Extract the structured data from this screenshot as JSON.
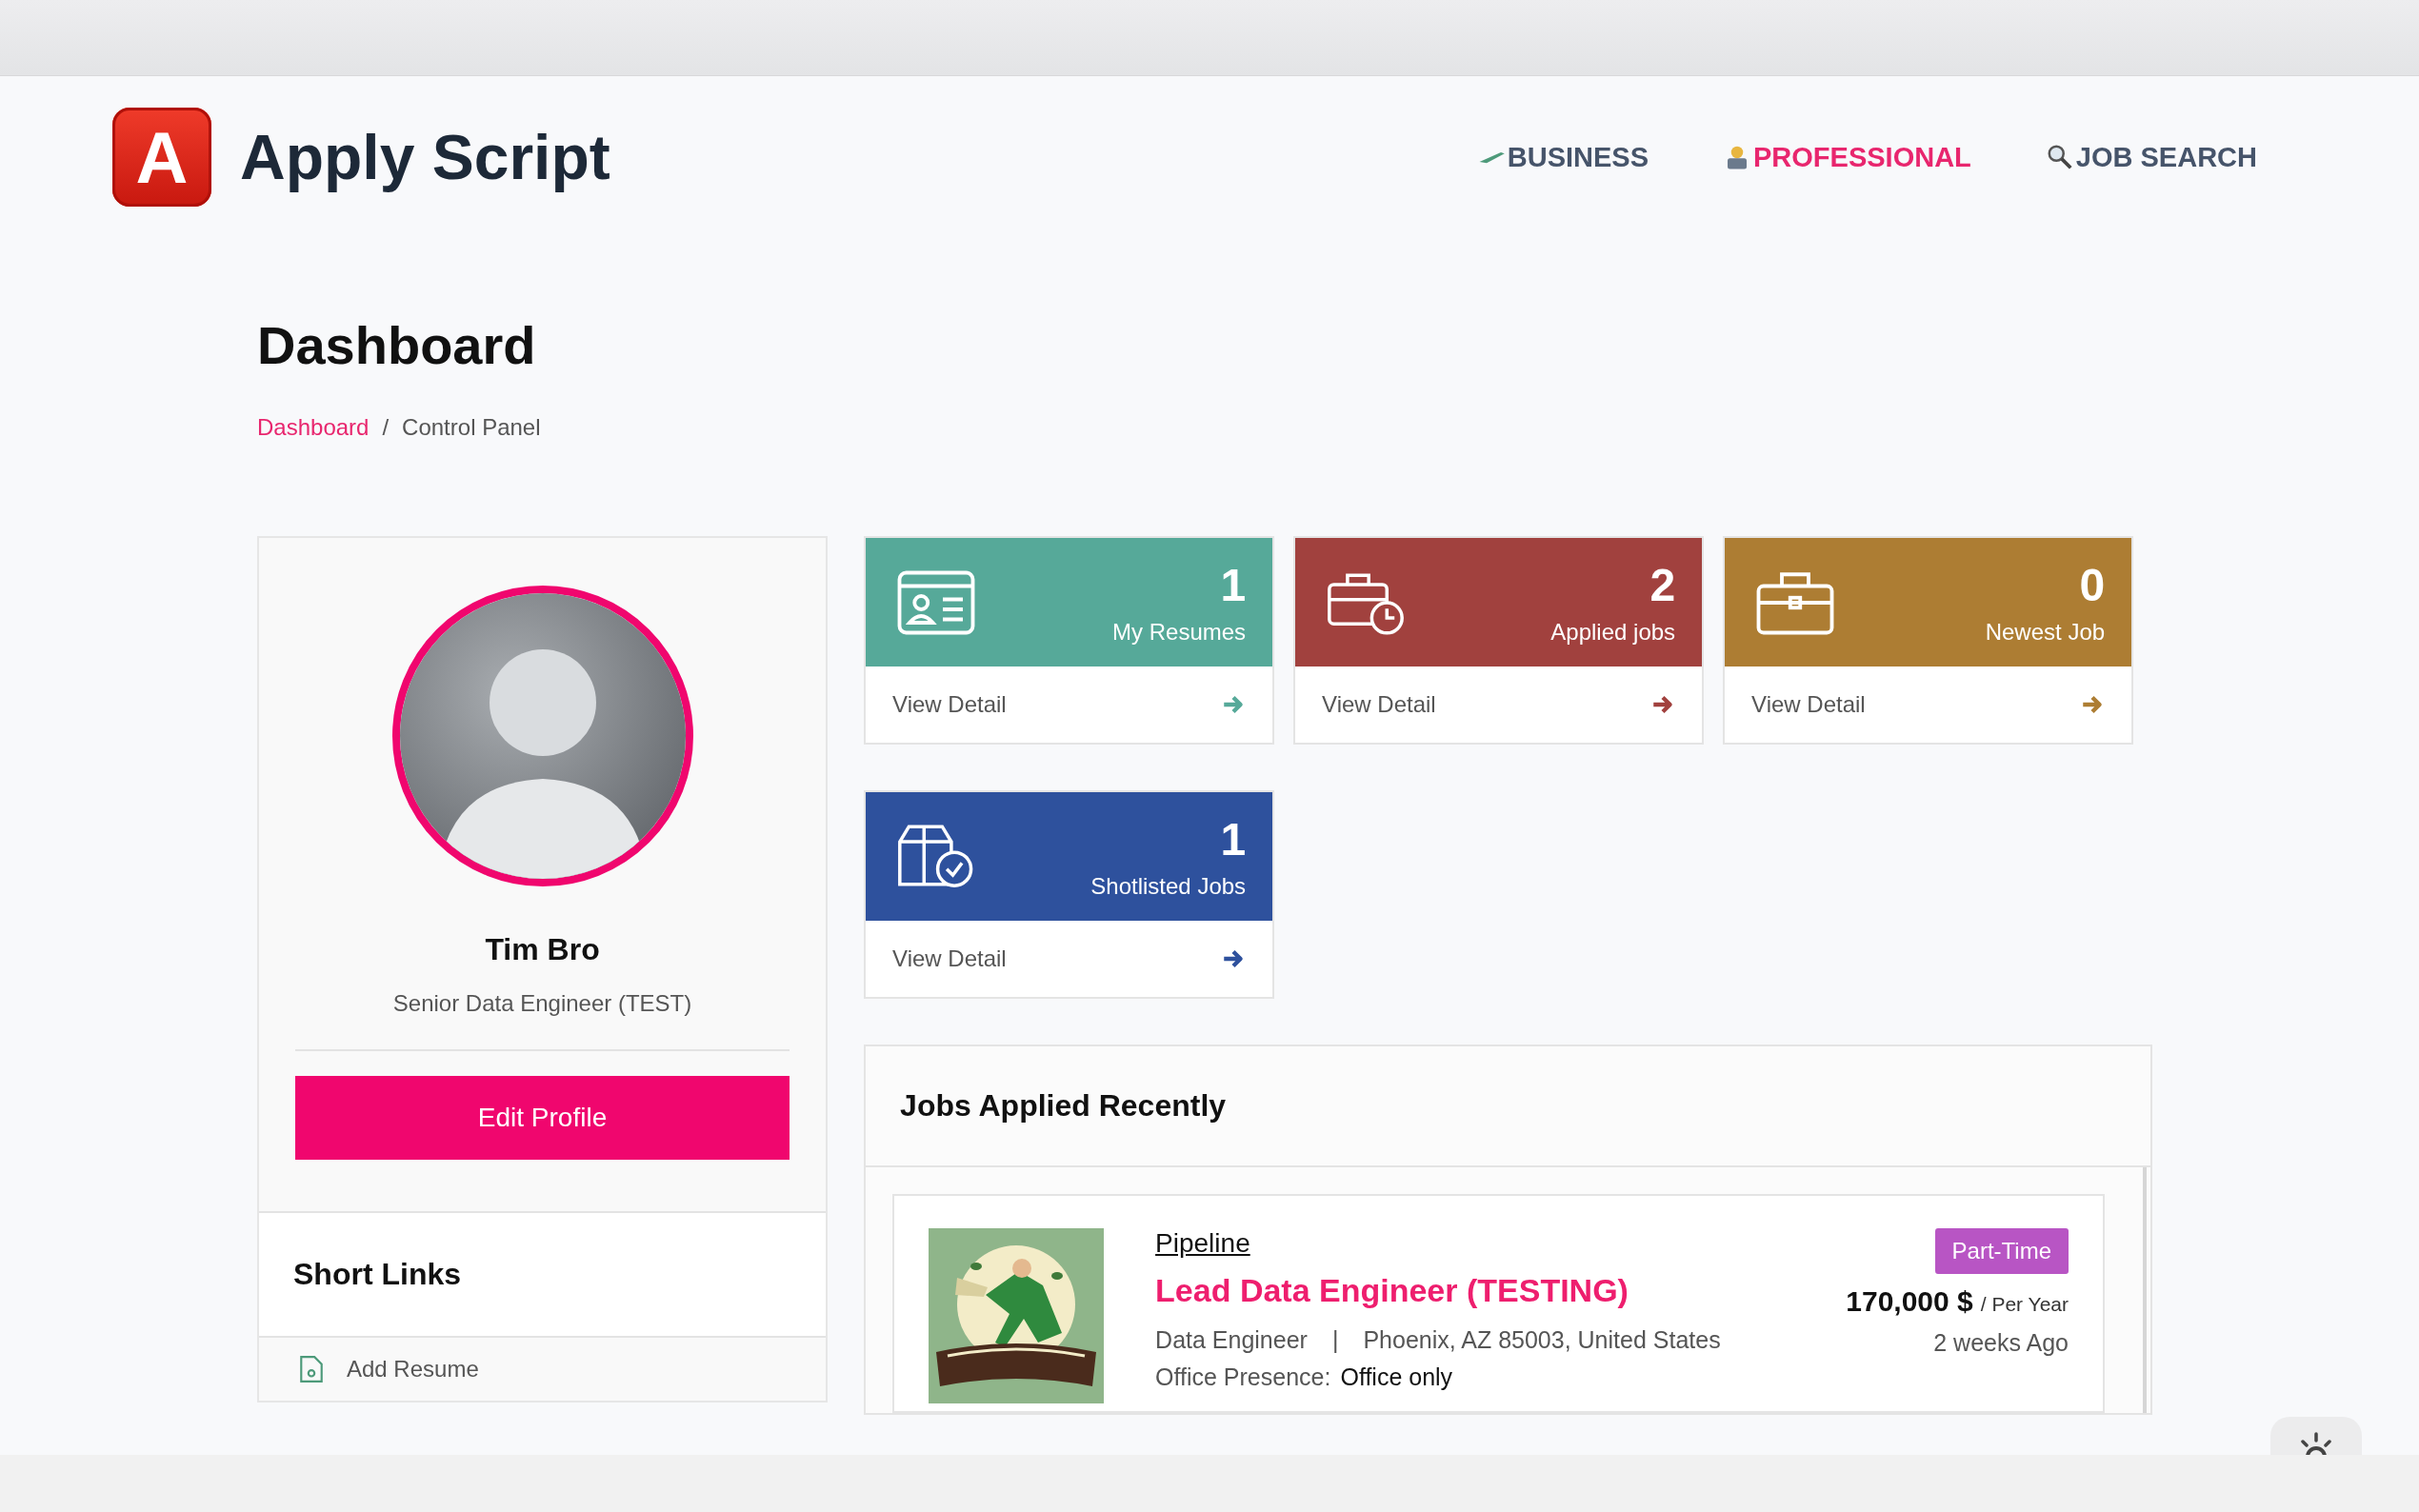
{
  "brand": {
    "logo_letter": "A",
    "name": "Apply Script"
  },
  "nav": [
    {
      "label": "BUSINESS",
      "kind": "business",
      "selected": false
    },
    {
      "label": "PROFESSIONAL",
      "kind": "professional",
      "selected": true
    },
    {
      "label": "JOB SEARCH",
      "kind": "search",
      "selected": false
    }
  ],
  "page": {
    "title": "Dashboard",
    "breadcrumb_separator": "/",
    "breadcrumb": [
      {
        "label": "Dashboard",
        "kind": "link"
      },
      {
        "label": "Control Panel",
        "kind": "current"
      }
    ]
  },
  "profile": {
    "name": "Tim Bro",
    "headline": "Senior Data Engineer (TEST)",
    "button": "Edit Profile"
  },
  "short_links": {
    "title": "Short Links",
    "items": [
      {
        "label": "Add Resume",
        "kind": "resume"
      }
    ]
  },
  "stats": [
    {
      "count": "1",
      "label": "My Resumes",
      "link": "View Detail",
      "color": "#56a999",
      "kind": "resume"
    },
    {
      "count": "2",
      "label": "Applied jobs",
      "link": "View Detail",
      "color": "#a1413e",
      "kind": "applied"
    },
    {
      "count": "0",
      "label": "Newest Job",
      "link": "View Detail",
      "color": "#ad7d33",
      "kind": "newest"
    },
    {
      "count": "1",
      "label": "Shotlisted Jobs",
      "link": "View Detail",
      "color": "#2e519d",
      "kind": "shortlisted"
    }
  ],
  "recent_jobs": {
    "title": "Jobs Applied Recently",
    "items": [
      {
        "kind": "picture",
        "company": "Pipeline",
        "title": "Lead Data Engineer (TESTING)",
        "category": "Data Engineer",
        "separator": "|",
        "location": "Phoenix, AZ 85003, United States",
        "type": "Part-Time",
        "salary": "170,000 $",
        "period": "/ Per Year",
        "posted": "2 weeks Ago",
        "presence_label": "Office Presence:",
        "presence": "Office only"
      }
    ]
  }
}
